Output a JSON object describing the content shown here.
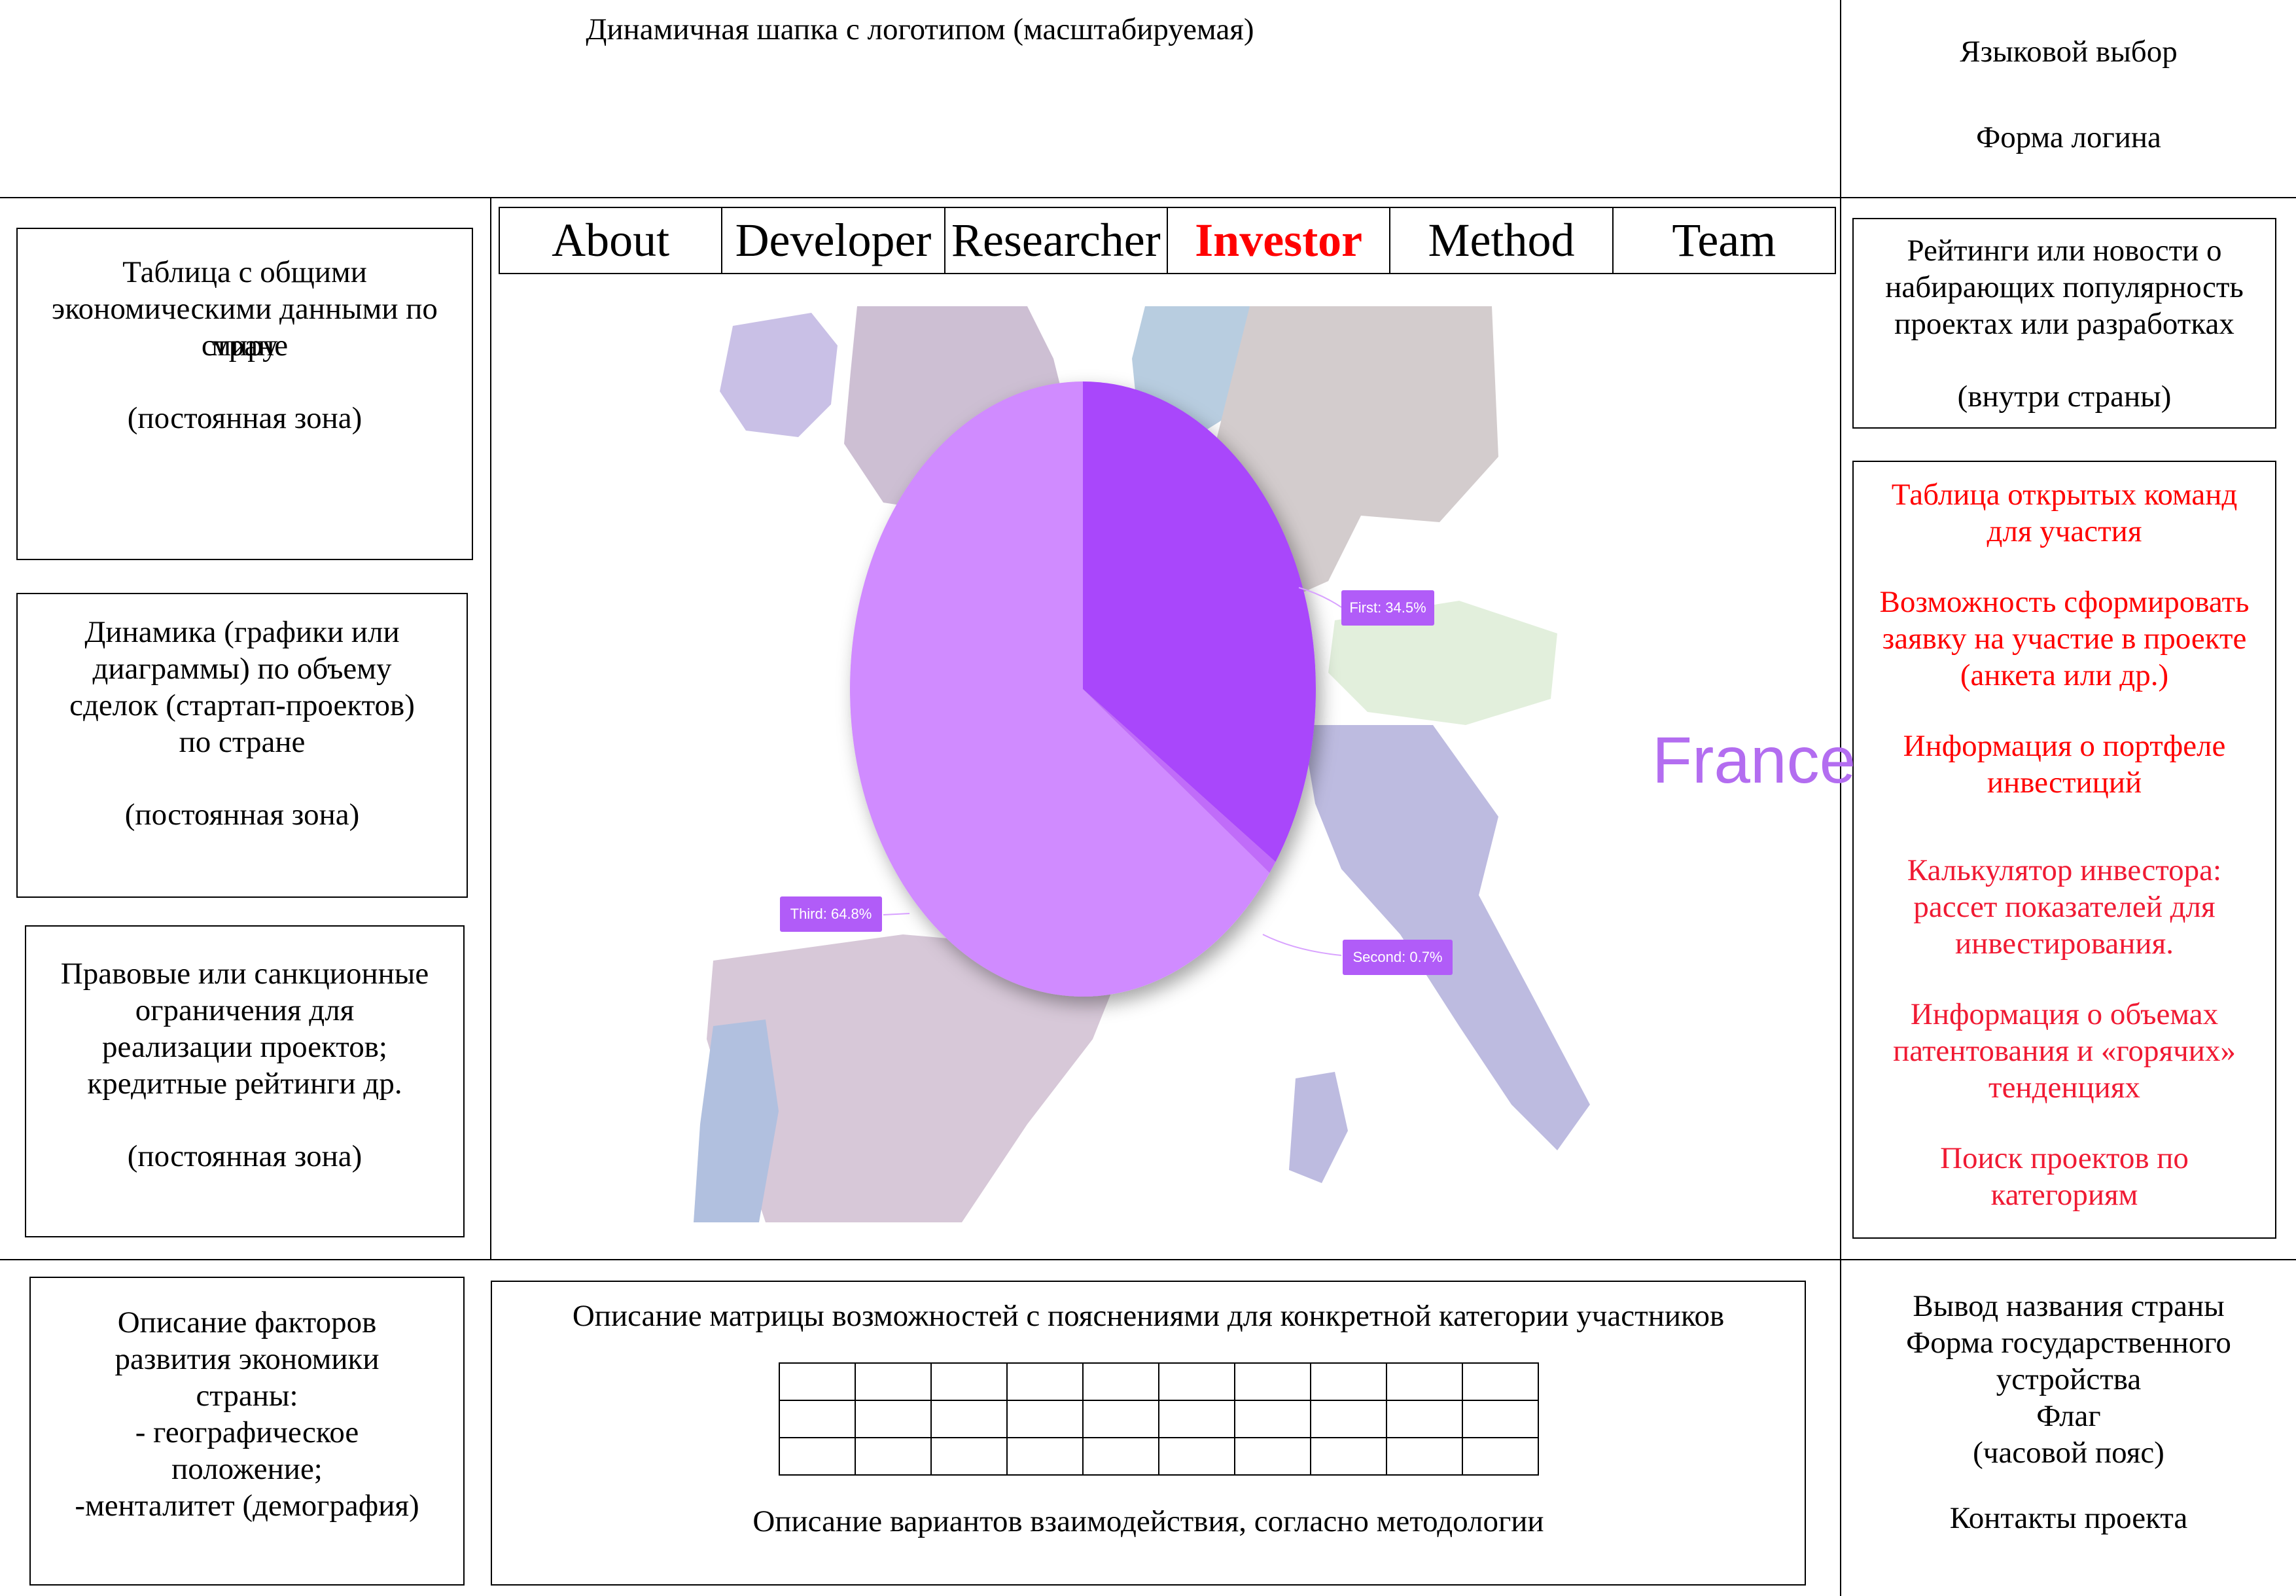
{
  "header": {
    "logo_text": "Динамичная шапка с логотипом (масштабируемая)",
    "language_select": "Языковой выбор",
    "login_form": "Форма логина"
  },
  "nav": {
    "items": [
      "About",
      "Developer",
      "Researcher",
      "Investor",
      "Method",
      "Team"
    ],
    "active": "Investor"
  },
  "left_panel": {
    "box1": {
      "line1": "Таблица с общими",
      "line2": "экономическими данными по",
      "line3": "стране",
      "line3_overlap": "миру",
      "note": "(постоянная зона)"
    },
    "box2": {
      "lines": [
        "Динамика (графики или",
        "диаграммы) по объему",
        "сделок (стартап-проектов)",
        "по стране"
      ],
      "note": "(постоянная зона)"
    },
    "box3": {
      "lines": [
        "Правовые или санкционные",
        "ограничения для",
        "реализации проектов;",
        "кредитные рейтинги др."
      ],
      "note": "(постоянная зона)"
    },
    "box4": {
      "lines": [
        "Описание факторов",
        "развития экономики",
        "страны:",
        "- географическое",
        "положение;",
        "-менталитет (демография)"
      ]
    }
  },
  "right_panel": {
    "box1": {
      "lines": [
        "Рейтинги или новости о",
        "набирающих популярность",
        "проектах или разработках"
      ],
      "note": "(внутри страны)"
    },
    "box2": {
      "group1": [
        "Таблица открытых команд",
        "для участия"
      ],
      "group2": [
        "Возможность сформировать",
        "заявку на участие в проекте",
        "(анкета или др.)"
      ],
      "group3": [
        "Информация о портфеле",
        "инвестиций"
      ],
      "group4": [
        "Калькулятор инвестора:",
        "рассет показателей для",
        "инвестирования."
      ],
      "group5": [
        "Информация о объемах",
        "патентования и «горячих»",
        "тенденциях"
      ],
      "group6": [
        "Поиск проектов по",
        "категориям"
      ]
    },
    "box3": {
      "lines": [
        "Вывод названия страны",
        "Форма государственного",
        "устройства",
        "Флаг",
        "(часовой пояс)"
      ],
      "contacts": "Контакты проекта"
    }
  },
  "main": {
    "country_name": "France",
    "colors": {
      "pie_main": "#d08bff",
      "pie_first": "#a946fb",
      "pie_second": "#c06cf9",
      "label_bg": "#b15cf8",
      "country_text": "#b36df0"
    }
  },
  "chart_data": {
    "type": "pie",
    "slices": [
      {
        "label": "First",
        "value": 34.5
      },
      {
        "label": "Second",
        "value": 0.7
      },
      {
        "label": "Third",
        "value": 64.8
      }
    ],
    "label_texts": {
      "first": "First: 34.5%",
      "second": "Second: 0.7%",
      "third": "Third: 64.8%"
    }
  },
  "bottom": {
    "matrix_title": "Описание матрицы возможностей с пояснениями для конкретной категории участников",
    "matrix_rows": 3,
    "matrix_cols": 10,
    "interaction_text": "Описание вариантов взаимодействия, согласно методологии"
  }
}
